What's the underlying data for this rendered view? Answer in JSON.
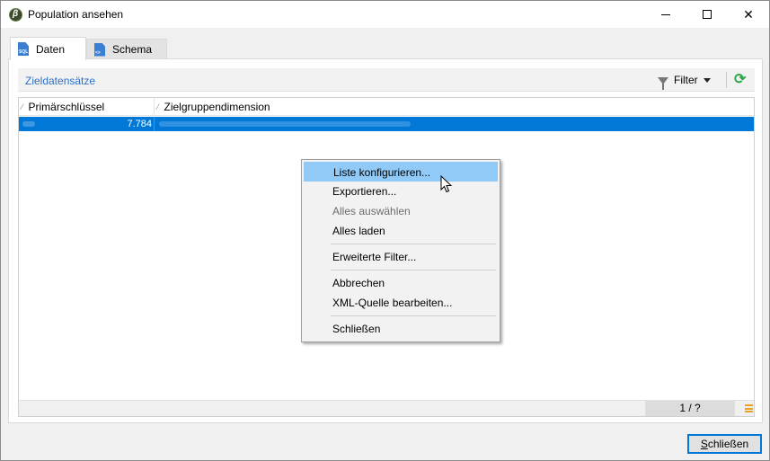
{
  "window": {
    "title": "Population ansehen",
    "controls": {
      "minimize": "minimize",
      "maximize": "maximize",
      "close": "close"
    }
  },
  "tabs": [
    {
      "label": "Daten",
      "icon": "sql-file-icon",
      "icon_text": "SQL",
      "active": true
    },
    {
      "label": "Schema",
      "icon": "xml-file-icon",
      "icon_text": "<>",
      "active": false
    }
  ],
  "toolbar": {
    "title": "Zieldatensätze",
    "filter_label": "Filter",
    "refresh_icon": "refresh-icon"
  },
  "grid": {
    "columns": [
      "Primärschlüssel",
      "Zielgruppendimension"
    ],
    "rows": [
      {
        "primary_key": "7.784",
        "dimension": ""
      }
    ],
    "page_counter": "1 / ?"
  },
  "context_menu": {
    "items": [
      {
        "label": "Liste konfigurieren...",
        "state": "hover"
      },
      {
        "label": "Exportieren...",
        "state": "normal"
      },
      {
        "label": "Alles auswählen",
        "state": "disabled"
      },
      {
        "label": "Alles laden",
        "state": "normal"
      },
      {
        "separator": true
      },
      {
        "label": "Erweiterte Filter...",
        "state": "normal"
      },
      {
        "separator": true
      },
      {
        "label": "Abbrechen",
        "state": "normal"
      },
      {
        "label": "XML-Quelle bearbeiten...",
        "state": "normal"
      },
      {
        "separator": true
      },
      {
        "label": "Schließen",
        "state": "normal"
      }
    ]
  },
  "footer": {
    "close_button": "Schließen",
    "close_button_prefix": "",
    "close_button_mnemonic": "S",
    "close_button_rest": "chließen"
  },
  "colors": {
    "accent": "#0078d7",
    "link": "#2e6fc4",
    "refresh": "#2fa84a",
    "menu_hover": "#91c9f7"
  }
}
